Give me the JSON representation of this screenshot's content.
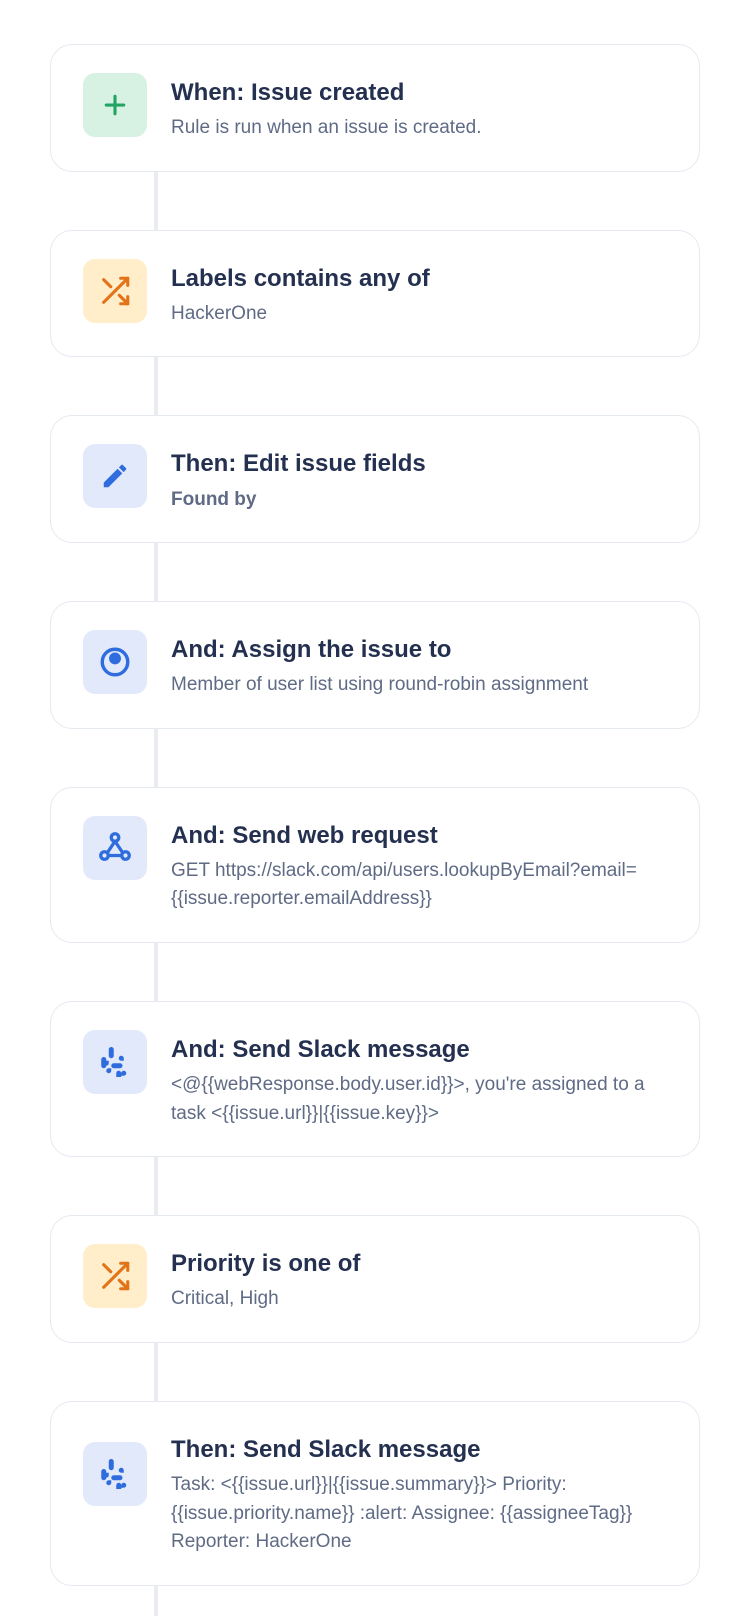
{
  "steps": [
    {
      "title": "When: Issue created",
      "sub": "Rule is run when an issue is created.",
      "subBold": false,
      "icon": "plus-icon",
      "iconVariant": "green"
    },
    {
      "title": "Labels contains any of",
      "sub": "HackerOne",
      "subBold": false,
      "icon": "shuffle-icon",
      "iconVariant": "yellow"
    },
    {
      "title": "Then: Edit issue fields",
      "sub": "Found by",
      "subBold": true,
      "icon": "pencil-icon",
      "iconVariant": "blue"
    },
    {
      "title": "And: Assign the issue to",
      "sub": "Member of user list using round-robin assignment",
      "subBold": false,
      "icon": "user-icon",
      "iconVariant": "blue"
    },
    {
      "title": "And: Send web request",
      "sub": "GET https://slack.com/api/users.lookupByEmail?email={{issue.reporter.emailAddress}}",
      "subBold": false,
      "icon": "webhook-icon",
      "iconVariant": "blue"
    },
    {
      "title": "And: Send Slack message",
      "sub": "<@{{webResponse.body.user.id}}>, you're assigned to a task <{{issue.url}}|{{issue.key}}>",
      "subBold": false,
      "icon": "slack-icon",
      "iconVariant": "blue"
    },
    {
      "title": "Priority is one of",
      "sub": "Critical, High",
      "subBold": false,
      "icon": "shuffle-icon",
      "iconVariant": "yellow"
    },
    {
      "title": "Then: Send Slack message",
      "sub": "Task: <{{issue.url}}|{{issue.summary}}> Priority: {{issue.priority.name}} :alert: Assignee: {{assigneeTag}} Reporter: HackerOne",
      "subBold": false,
      "icon": "slack-icon",
      "iconVariant": "blue"
    }
  ],
  "colors": {
    "green": "#23a465",
    "orange": "#e27318",
    "blue": "#2f6cde"
  }
}
